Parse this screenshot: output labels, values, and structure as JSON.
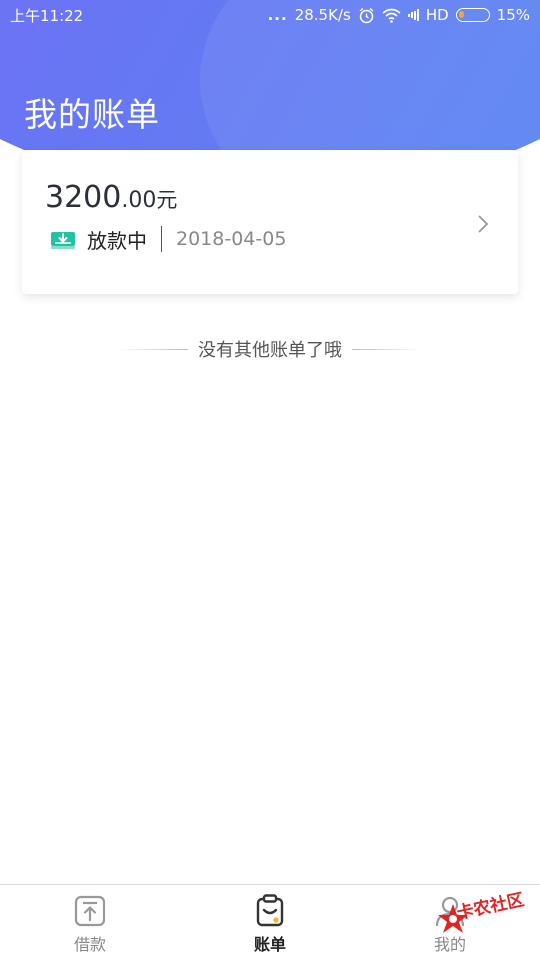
{
  "status_bar": {
    "time": "上午11:22",
    "dots": "...",
    "speed": "28.5K/s",
    "network_label": "HD",
    "battery_percent": "15%",
    "battery_level": 0.15
  },
  "header": {
    "title": "我的账单"
  },
  "bill": {
    "amount_int": "3200",
    "amount_dec": ".00",
    "amount_unit": "元",
    "status": "放款中",
    "date": "2018-04-05"
  },
  "list_end": {
    "text": "没有其他账单了哦"
  },
  "tabs": [
    {
      "label": "借款",
      "icon": "borrow-icon",
      "active": false
    },
    {
      "label": "账单",
      "icon": "bill-icon",
      "active": true
    },
    {
      "label": "我的",
      "icon": "profile-icon",
      "active": false
    }
  ],
  "watermark": {
    "text": "卡农社区"
  },
  "colors": {
    "gradient_start": "#8b6cf6",
    "gradient_end": "#4d8bf1",
    "accent_teal": "#21c3a2",
    "active_dot": "#f5b325",
    "watermark_red": "#e02424"
  }
}
